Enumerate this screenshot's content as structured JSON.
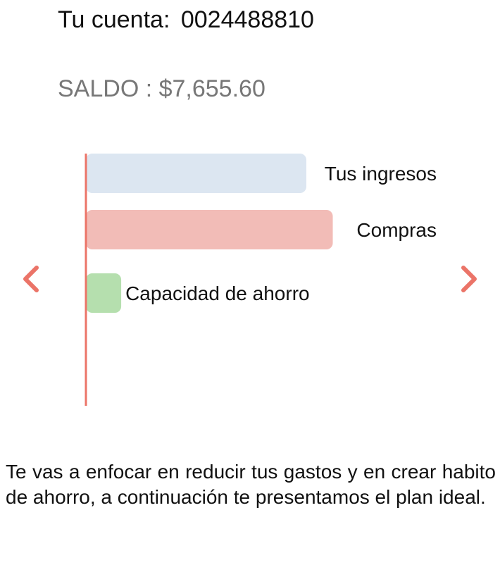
{
  "account": {
    "label": "Tu cuenta:",
    "number": "0024488810"
  },
  "balance": {
    "text": "SALDO : $7,655.60"
  },
  "navigation": {
    "prev_icon": "chevron-left-icon",
    "next_icon": "chevron-right-icon",
    "accent_color": "#EB7468"
  },
  "chart_data": {
    "type": "bar",
    "orientation": "horizontal",
    "categories": [
      "Tus ingresos",
      "Compras",
      "Capacidad de ahorro"
    ],
    "values": [
      100,
      112,
      16
    ],
    "colors": [
      "#DCE6F1",
      "#F2BCB7",
      "#B5DFAE"
    ],
    "axis_color": "#EB7468",
    "title": "",
    "xlabel": "",
    "ylabel": ""
  },
  "message": {
    "text": "Te vas a enfocar en reducir tus gastos y en crear habito de ahorro, a continuación te presentamos el plan ideal."
  }
}
